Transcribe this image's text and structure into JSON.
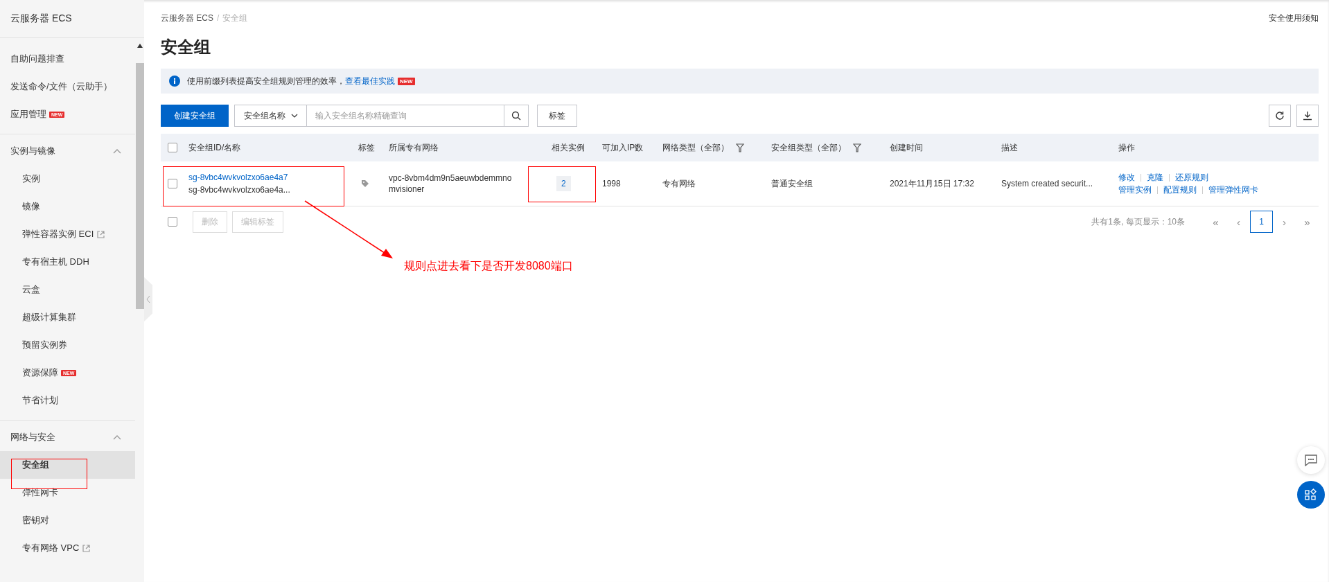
{
  "sidebar": {
    "title": "云服务器 ECS",
    "sections": [
      {
        "items": [
          {
            "label": "自助问题排查",
            "selected": false,
            "external": false
          },
          {
            "label": "发送命令/文件（云助手）",
            "selected": false,
            "external": false
          },
          {
            "label": "应用管理",
            "badge": "NEW",
            "selected": false,
            "external": false
          }
        ]
      },
      {
        "title": "实例与镜像",
        "expanded": true,
        "items": [
          {
            "label": "实例",
            "selected": false,
            "external": false
          },
          {
            "label": "镜像",
            "selected": false,
            "external": false
          },
          {
            "label": "弹性容器实例 ECI",
            "selected": false,
            "external": true
          },
          {
            "label": "专有宿主机 DDH",
            "selected": false,
            "external": false
          },
          {
            "label": "云盒",
            "selected": false,
            "external": false
          },
          {
            "label": "超级计算集群",
            "selected": false,
            "external": false
          },
          {
            "label": "预留实例券",
            "selected": false,
            "external": false
          },
          {
            "label": "资源保障",
            "badge": "NEW",
            "selected": false,
            "external": false
          },
          {
            "label": "节省计划",
            "selected": false,
            "external": false
          }
        ]
      },
      {
        "title": "网络与安全",
        "expanded": true,
        "items": [
          {
            "label": "安全组",
            "selected": true,
            "external": false
          },
          {
            "label": "弹性网卡",
            "selected": false,
            "external": false
          },
          {
            "label": "密钥对",
            "selected": false,
            "external": false
          },
          {
            "label": "专有网络 VPC",
            "selected": false,
            "external": true
          }
        ]
      }
    ]
  },
  "breadcrumb": [
    "云服务器 ECS",
    "安全组"
  ],
  "breadcrumb_separator": "/",
  "help_link": "安全使用须知",
  "title": "安全组",
  "notice": {
    "text": "使用前缀列表提高安全组规则管理的效率，",
    "link": "查看最佳实践",
    "badge": "NEW"
  },
  "toolbar": {
    "create_button": "创建安全组",
    "filter": "安全组名称",
    "placeholder": "输入安全组名称精确查询",
    "tag_button": "标签"
  },
  "table": {
    "header_checked": false,
    "columns": [
      {
        "label": "安全组ID/名称",
        "filter": false
      },
      {
        "label": "标签",
        "filter": false
      },
      {
        "label": "所属专有网络",
        "filter": false
      },
      {
        "label": "相关实例",
        "filter": false
      },
      {
        "label": "可加入IP数",
        "filter": false
      },
      {
        "label": "网络类型（全部）",
        "filter": true
      },
      {
        "label": "安全组类型（全部）",
        "filter": true
      },
      {
        "label": "创建时间",
        "filter": false
      },
      {
        "label": "描述",
        "filter": false
      },
      {
        "label": "操作",
        "filter": false
      }
    ],
    "rows": [
      {
        "checked": false,
        "id": "sg-8vbc4wvkvolzxo6ae4a7",
        "name": "sg-8vbc4wvkvolzxo6ae4a...",
        "vpc": "vpc-8vbm4dm9n5aeuwbdemmnomvisioner",
        "related": "2",
        "ip_count": "1998",
        "net_type": "专有网络",
        "sg_type": "普通安全组",
        "created": "2021年11月15日 17:32",
        "description": "System created securit...",
        "actions": [
          [
            "修改",
            "克隆",
            "还原规则"
          ],
          [
            "管理实例",
            "配置规则",
            "管理弹性网卡"
          ]
        ]
      }
    ],
    "footer_checked": false,
    "footer_buttons": [
      {
        "label": "删除",
        "disabled": true
      },
      {
        "label": "编辑标签",
        "disabled": true
      }
    ]
  },
  "pagination": {
    "summary": "共有1条, 每页显示：10条",
    "first": "«",
    "previous": "‹",
    "pages": [
      {
        "label": "1",
        "selected": true
      }
    ],
    "next": "›",
    "last": "»"
  },
  "annotation": {
    "text": "规则点进去看下是否开发8080端口"
  }
}
